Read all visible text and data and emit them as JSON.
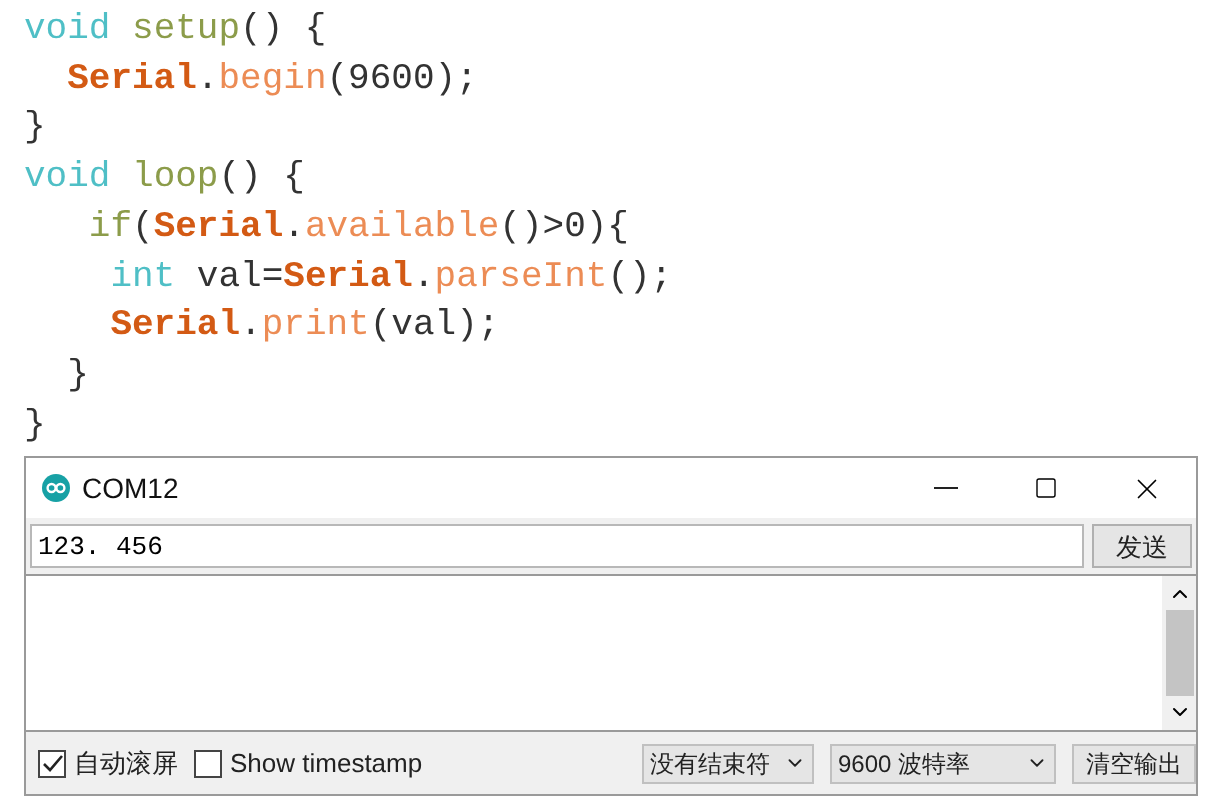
{
  "code": [
    [
      {
        "text": "void ",
        "kind": "keyword"
      },
      {
        "text": "setup",
        "kind": "function"
      },
      {
        "text": "() {",
        "kind": "plain"
      }
    ],
    [
      {
        "text": "  Serial",
        "kind": "class"
      },
      {
        "text": ".",
        "kind": "plain"
      },
      {
        "text": "begin",
        "kind": "method"
      },
      {
        "text": "(9600);",
        "kind": "plain"
      }
    ],
    [
      {
        "text": "}",
        "kind": "plain"
      }
    ],
    [
      {
        "text": "void ",
        "kind": "keyword"
      },
      {
        "text": "loop",
        "kind": "function"
      },
      {
        "text": "() {",
        "kind": "plain"
      }
    ],
    [
      {
        "text": "   if",
        "kind": "function"
      },
      {
        "text": "(",
        "kind": "plain"
      },
      {
        "text": "Serial",
        "kind": "class"
      },
      {
        "text": ".",
        "kind": "plain"
      },
      {
        "text": "available",
        "kind": "method"
      },
      {
        "text": "()>0){",
        "kind": "plain"
      }
    ],
    [
      {
        "text": "    int",
        "kind": "keyword"
      },
      {
        "text": " val=",
        "kind": "plain"
      },
      {
        "text": "Serial",
        "kind": "class"
      },
      {
        "text": ".",
        "kind": "plain"
      },
      {
        "text": "parseInt",
        "kind": "method"
      },
      {
        "text": "();",
        "kind": "plain"
      }
    ],
    [
      {
        "text": "    Serial",
        "kind": "class"
      },
      {
        "text": ".",
        "kind": "plain"
      },
      {
        "text": "print",
        "kind": "method"
      },
      {
        "text": "(val);",
        "kind": "plain"
      }
    ],
    [
      {
        "text": "  }",
        "kind": "plain"
      }
    ],
    [
      {
        "text": "}",
        "kind": "plain"
      }
    ]
  ],
  "monitor": {
    "title": "COM12",
    "input": {
      "value": "123. 456"
    },
    "send_button": "发送",
    "autoscroll": {
      "label": "自动滚屏",
      "checked": true
    },
    "timestamp": {
      "label": "Show timestamp",
      "checked": false
    },
    "line_ending": "没有结束符",
    "baud_rate": "9600 波特率",
    "clear_button": "清空输出"
  }
}
